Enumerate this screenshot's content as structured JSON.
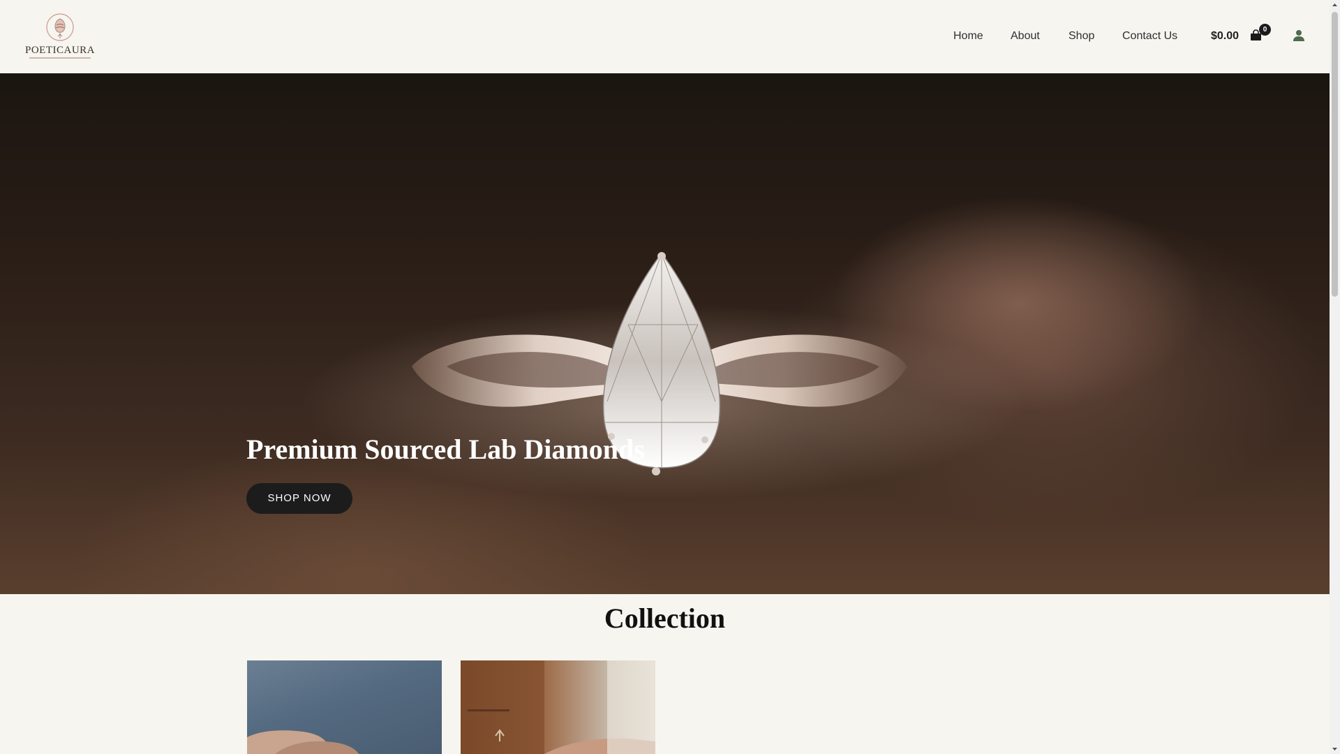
{
  "brand": {
    "name": "POETICAURA"
  },
  "nav": {
    "items": [
      {
        "label": "Home"
      },
      {
        "label": "About"
      },
      {
        "label": "Shop"
      },
      {
        "label": "Contact Us"
      }
    ]
  },
  "cart": {
    "total": "$0.00",
    "count": "0"
  },
  "icons": {
    "cart": "shopping-bag-icon",
    "account": "user-icon",
    "logo": "rose-logo-icon"
  },
  "hero": {
    "title": "Premium Sourced Lab Diamonds",
    "cta_label": "SHOP NOW"
  },
  "collection": {
    "title": "Collection"
  },
  "colors": {
    "background": "#f7f5f0",
    "button": "#1c1c1c",
    "account_icon": "#4f6b4f"
  }
}
